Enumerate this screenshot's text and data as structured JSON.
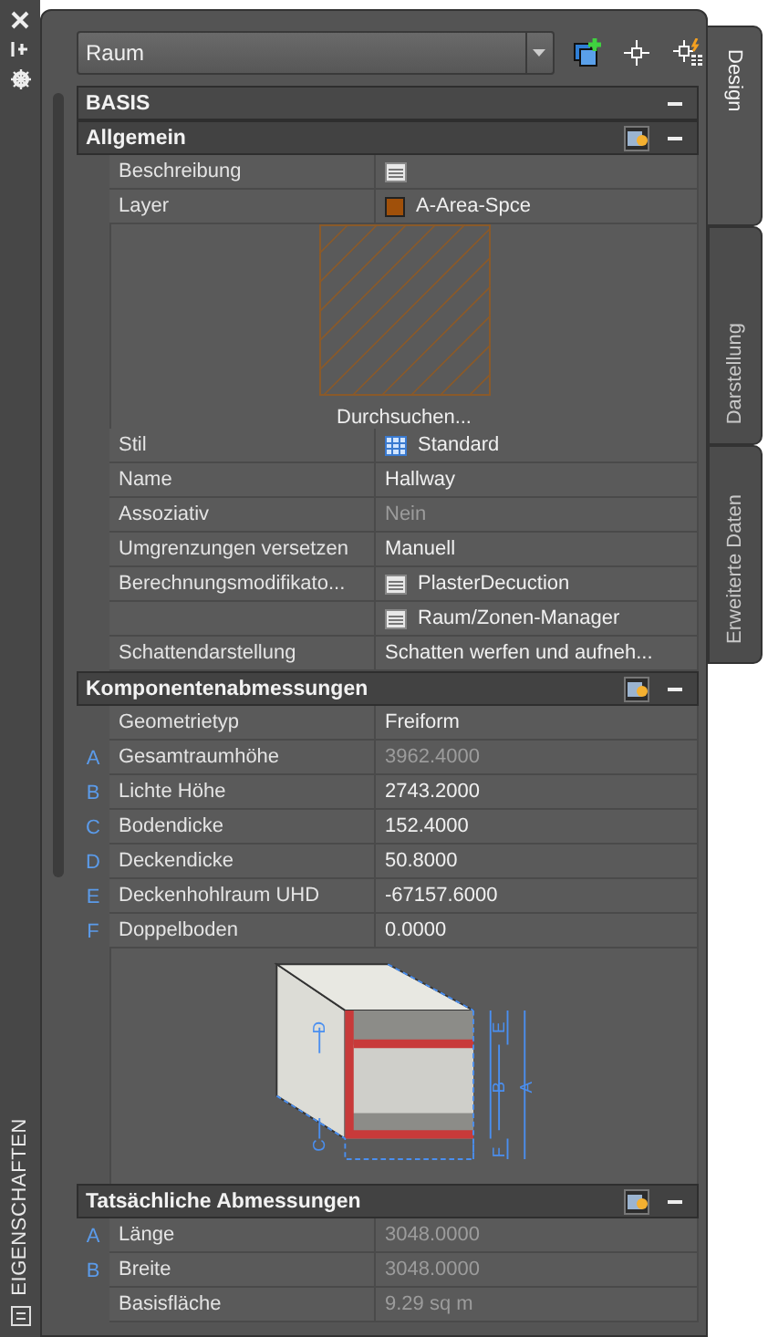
{
  "toolbar": {
    "object_type": "Raum"
  },
  "palette": {
    "title": "EIGENSCHAFTEN"
  },
  "side_tabs": [
    {
      "label": "Design",
      "selected": true
    },
    {
      "label": "Darstellung",
      "selected": false
    },
    {
      "label": "Erweiterte Daten",
      "selected": false
    }
  ],
  "sections": [
    {
      "title": "BASIS",
      "kind": "category",
      "expanded": true
    },
    {
      "title": "Allgemein",
      "kind": "group",
      "expanded": true,
      "rows": [
        {
          "kind": "icon",
          "label": "Beschreibung"
        },
        {
          "kind": "swatch",
          "label": "Layer",
          "value": "A-Area-Spce",
          "color": "#a0500a"
        },
        {
          "kind": "preview",
          "value": "Durchsuchen..."
        },
        {
          "kind": "style",
          "label": "Stil",
          "value": "Standard"
        },
        {
          "kind": "text",
          "label": "Name",
          "value": "Hallway",
          "disabled": false
        },
        {
          "kind": "text",
          "label": "Assoziativ",
          "value": "Nein",
          "disabled": true
        },
        {
          "kind": "text",
          "label": "Umgrenzungen versetzen",
          "value": "Manuell",
          "disabled": false
        },
        {
          "kind": "list",
          "label": "Berechnungsmodifikato...",
          "value": "PlasterDecuction"
        },
        {
          "kind": "list",
          "value": "Raum/Zonen-Manager"
        },
        {
          "kind": "text",
          "label": "Schattendarstellung",
          "value": "Schatten werfen und aufneh...",
          "disabled": false
        }
      ]
    },
    {
      "title": "Komponentenabmessungen",
      "kind": "group",
      "expanded": true,
      "rows": [
        {
          "kind": "text",
          "label": "Geometrietyp",
          "value": "Freiform",
          "disabled": false
        },
        {
          "kind": "text",
          "letter": "A",
          "label": "Gesamtraumhöhe",
          "value": "3962.4000",
          "disabled": true
        },
        {
          "kind": "text",
          "letter": "B",
          "label": "Lichte Höhe",
          "value": "2743.2000",
          "disabled": false
        },
        {
          "kind": "text",
          "letter": "C",
          "label": "Bodendicke",
          "value": "152.4000",
          "disabled": false
        },
        {
          "kind": "text",
          "letter": "D",
          "label": "Deckendicke",
          "value": "50.8000",
          "disabled": false
        },
        {
          "kind": "text",
          "letter": "E",
          "label": "Deckenhohlraum UHD",
          "value": "-67157.6000",
          "disabled": false
        },
        {
          "kind": "text",
          "letter": "F",
          "label": "Doppelboden",
          "value": "0.0000",
          "disabled": false
        },
        {
          "kind": "diagram",
          "labels": [
            "D",
            "E",
            "B",
            "A",
            "C",
            "F"
          ]
        }
      ]
    },
    {
      "title": "Tatsächliche Abmessungen",
      "kind": "group",
      "expanded": true,
      "rows": [
        {
          "kind": "text",
          "letter": "A",
          "label": "Länge",
          "value": "3048.0000",
          "disabled": true
        },
        {
          "kind": "text",
          "letter": "B",
          "label": "Breite",
          "value": "3048.0000",
          "disabled": true
        },
        {
          "kind": "text",
          "label": "Basisfläche",
          "value": "9.29 sq m",
          "disabled": true
        }
      ]
    }
  ]
}
